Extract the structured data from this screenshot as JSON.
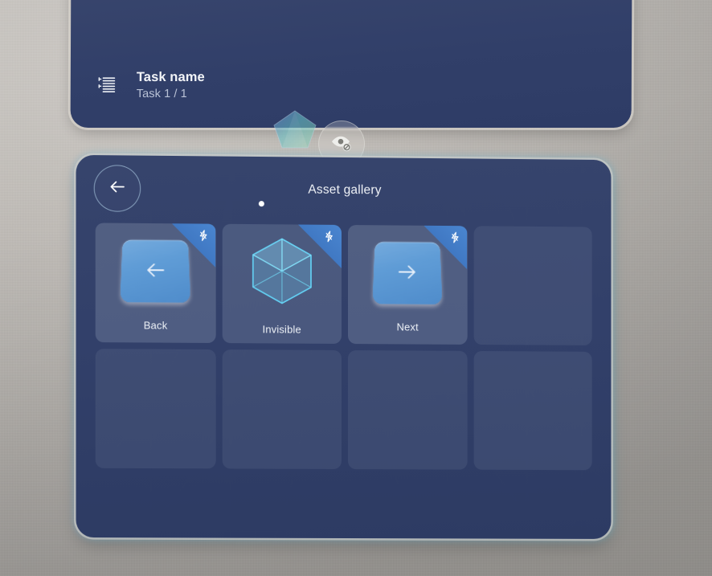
{
  "environment": {
    "type": "vr-passthrough",
    "wall_color": "#b8b4af"
  },
  "task_panel": {
    "icon": "task-list-icon",
    "task_name": "Task name",
    "task_count": "Task 1 / 1",
    "panel_color": "#32406a"
  },
  "floating_controls": {
    "gem": {
      "icon": "gem-polyhedron-icon"
    },
    "hide_toggle": {
      "icon": "eye-off-icon",
      "label": "Hide"
    }
  },
  "gallery": {
    "title": "Asset gallery",
    "back_button_icon": "arrow-left-icon",
    "page_dots": {
      "count": 1,
      "active_index": 0
    },
    "badge_icon": "lightning-bolt-icon",
    "accent_color": "#3f77c2",
    "cube_color": "#5fd0ee",
    "assets": [
      {
        "label": "Back",
        "icon": "arrow-left-plate-icon",
        "badge": true,
        "empty": false
      },
      {
        "label": "Invisible",
        "icon": "wireframe-cube-icon",
        "badge": true,
        "empty": false
      },
      {
        "label": "Next",
        "icon": "arrow-right-plate-icon",
        "badge": true,
        "empty": false
      },
      {
        "label": "",
        "icon": "",
        "badge": false,
        "empty": true
      },
      {
        "label": "",
        "icon": "",
        "badge": false,
        "empty": true
      },
      {
        "label": "",
        "icon": "",
        "badge": false,
        "empty": true
      },
      {
        "label": "",
        "icon": "",
        "badge": false,
        "empty": true
      },
      {
        "label": "",
        "icon": "",
        "badge": false,
        "empty": true
      }
    ]
  }
}
